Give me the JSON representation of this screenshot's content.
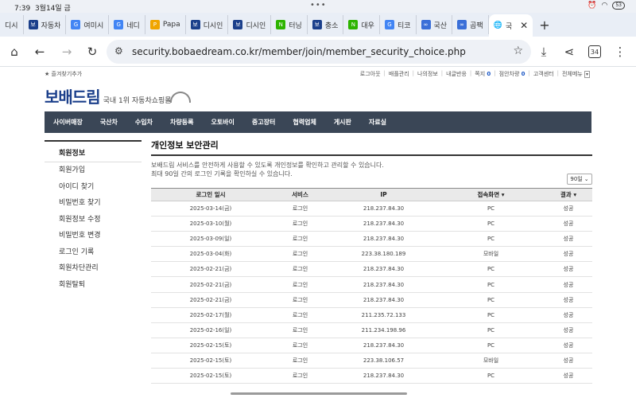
{
  "status": {
    "time": "7:39",
    "date": "3월14일 금",
    "battery": "53"
  },
  "tabs": [
    {
      "label": "디시",
      "fav": "",
      "color": "#ffffff"
    },
    {
      "label": "자동차",
      "fav": "보",
      "color": "#1b3f8b"
    },
    {
      "label": "여미시",
      "fav": "G",
      "color": "#4285f4"
    },
    {
      "label": "네디",
      "fav": "G",
      "color": "#4285f4"
    },
    {
      "label": "Papa",
      "fav": "P",
      "color": "#f0a500"
    },
    {
      "label": "디시인",
      "fav": "보",
      "color": "#1b3f8b"
    },
    {
      "label": "디시인",
      "fav": "보",
      "color": "#1b3f8b"
    },
    {
      "label": "터닝",
      "fav": "N",
      "color": "#2db400"
    },
    {
      "label": "충소",
      "fav": "보",
      "color": "#1b3f8b"
    },
    {
      "label": "대우",
      "fav": "N",
      "color": "#2db400"
    },
    {
      "label": "티코",
      "fav": "G",
      "color": "#4285f4"
    },
    {
      "label": "국산",
      "fav": "∞",
      "color": "#3a6fd8"
    },
    {
      "label": "곰팩",
      "fav": "∞",
      "color": "#3a6fd8"
    }
  ],
  "active_tab": {
    "label": "국",
    "close": "✕"
  },
  "new_tab": "+",
  "url": "security.bobaedream.co.kr/member/join/member_security_choice.php",
  "tab_count": "34",
  "util_left": "★ 즐겨찾기추가",
  "util_right": [
    {
      "label": "로그아웃",
      "num": ""
    },
    {
      "label": "배플관리",
      "num": ""
    },
    {
      "label": "나의정보",
      "num": ""
    },
    {
      "label": "내글반응",
      "num": ""
    },
    {
      "label": "쪽지",
      "num": "0"
    },
    {
      "label": "점안차량",
      "num": "0"
    },
    {
      "label": "고객센터",
      "num": ""
    },
    {
      "label": "전체메뉴",
      "num": ""
    }
  ],
  "logo": {
    "brand": "보배드림",
    "tagline": "국내 1위 자동차쇼핑몰"
  },
  "nav": [
    "사이버매장",
    "국산차",
    "수입차",
    "차량등록",
    "오토바이",
    "중고장터",
    "협력업체",
    "게시판",
    "자료실"
  ],
  "sidebar": {
    "title": "회원정보",
    "items": [
      "회원가입",
      "아이디 찾기",
      "비밀번호 찾기",
      "회원정보 수정",
      "비밀번호 변경",
      "로그인 기록",
      "회원차단관리",
      "회원탈퇴"
    ]
  },
  "content": {
    "title": "개인정보 보안관리",
    "desc1": "보배드림 서비스를 안전하게 사용할 수 있도록 개인정보를 확인하고 관리할 수 있습니다.",
    "desc2": "최대 90일 간의 로그인 기록을 확인하실 수 있습니다.",
    "period": "90일"
  },
  "table": {
    "headers": [
      "로그인 일시",
      "서비스",
      "IP",
      "접속화면 ▾",
      "결과 ▾"
    ],
    "rows": [
      [
        "2025-03-14(금)",
        "로그인",
        "218.237.84.30",
        "PC",
        "성공"
      ],
      [
        "2025-03-10(월)",
        "로그인",
        "218.237.84.30",
        "PC",
        "성공"
      ],
      [
        "2025-03-09(일)",
        "로그인",
        "218.237.84.30",
        "PC",
        "성공"
      ],
      [
        "2025-03-04(화)",
        "로그인",
        "223.38.180.189",
        "모바일",
        "성공"
      ],
      [
        "2025-02-21(금)",
        "로그인",
        "218.237.84.30",
        "PC",
        "성공"
      ],
      [
        "2025-02-21(금)",
        "로그인",
        "218.237.84.30",
        "PC",
        "성공"
      ],
      [
        "2025-02-21(금)",
        "로그인",
        "218.237.84.30",
        "PC",
        "성공"
      ],
      [
        "2025-02-17(월)",
        "로그인",
        "211.235.72.133",
        "PC",
        "성공"
      ],
      [
        "2025-02-16(일)",
        "로그인",
        "211.234.198.96",
        "PC",
        "성공"
      ],
      [
        "2025-02-15(토)",
        "로그인",
        "218.237.84.30",
        "PC",
        "성공"
      ],
      [
        "2025-02-15(토)",
        "로그인",
        "223.38.106.57",
        "모바일",
        "성공"
      ],
      [
        "2025-02-15(토)",
        "로그인",
        "218.237.84.30",
        "PC",
        "성공"
      ]
    ]
  }
}
